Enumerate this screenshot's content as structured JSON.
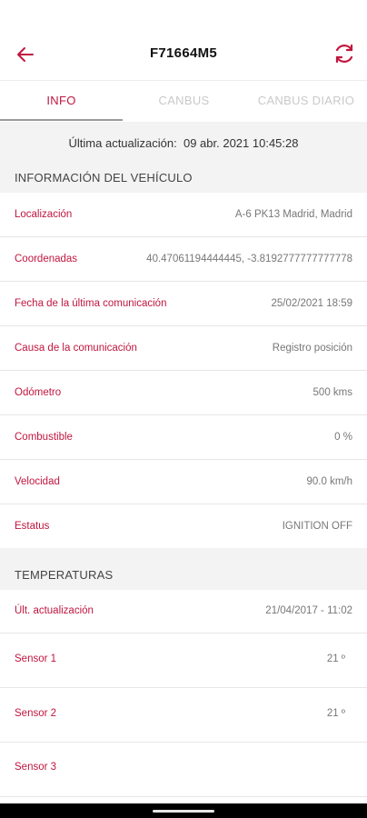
{
  "header": {
    "title": "F71664M5",
    "back_icon": "arrow-left-icon",
    "refresh_icon": "refresh-icon",
    "accent": "#c0163f"
  },
  "tabs": [
    {
      "label": "INFO",
      "active": true
    },
    {
      "label": "CANBUS",
      "active": false
    },
    {
      "label": "CANBUS DIARIO",
      "active": false
    }
  ],
  "last_update": {
    "label": "Última actualización:",
    "value": "09 abr. 2021 10:45:28"
  },
  "vehicle_section": {
    "title": "INFORMACIÓN DEL VEHÍCULO",
    "rows": [
      {
        "label": "Localización",
        "value": "A-6 PK13 Madrid, Madrid"
      },
      {
        "label": "Coordenadas",
        "value": "40.47061194444445, -3.8192777777777778"
      },
      {
        "label": "Fecha de la última comunicación",
        "value": "25/02/2021 18:59"
      },
      {
        "label": "Causa de la comunicación",
        "value": "Registro posición"
      },
      {
        "label": "Odómetro",
        "value": "500 kms"
      },
      {
        "label": "Combustible",
        "value": "0 %"
      },
      {
        "label": "Velocidad",
        "value": "90.0 km/h"
      },
      {
        "label": "Estatus",
        "value": "IGNITION OFF"
      }
    ]
  },
  "temperature_section": {
    "title": "TEMPERATURAS",
    "rows": [
      {
        "label": "Últ. actualización",
        "value": "21/04/2017  -  11:02"
      },
      {
        "label": "Sensor 1",
        "value": "21 º"
      },
      {
        "label": "Sensor 2",
        "value": "21 º"
      },
      {
        "label": "Sensor 3",
        "value": ""
      }
    ]
  }
}
